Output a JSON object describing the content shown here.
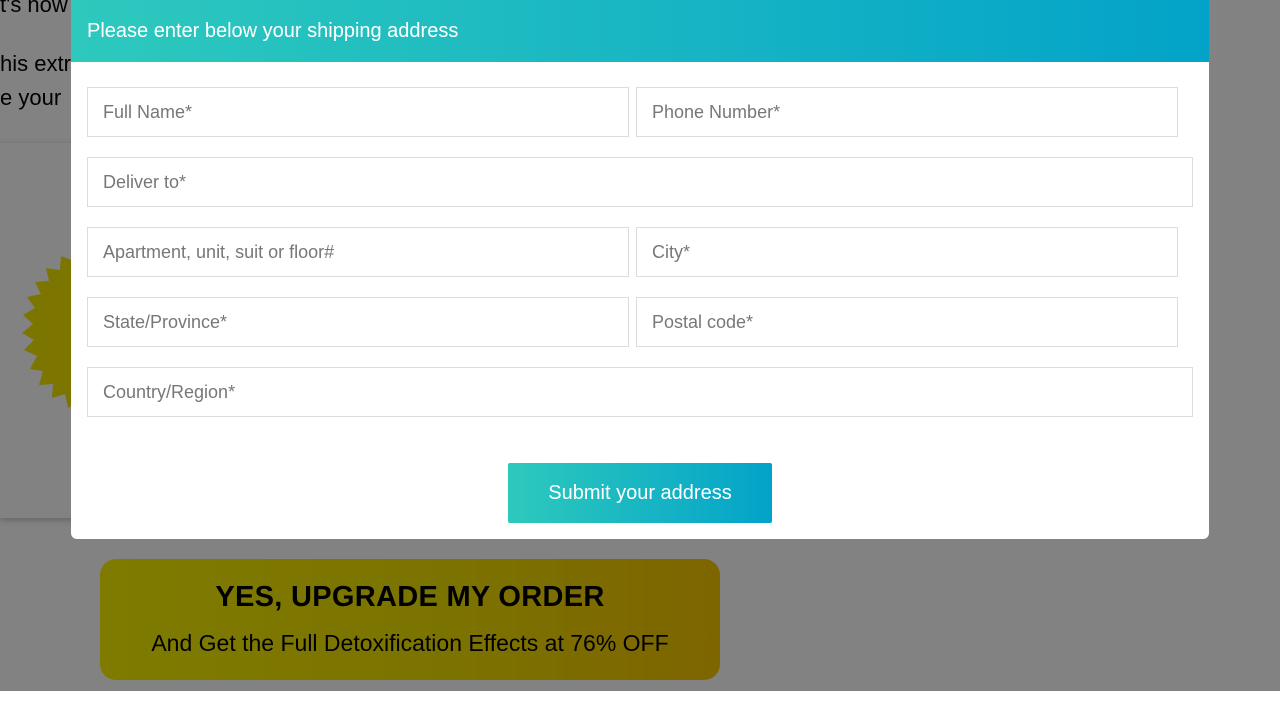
{
  "background_page": {
    "text_line_1": "t's now",
    "text_line_2": "his extr",
    "text_line_3": "e your",
    "upgrade_button": {
      "title": "YES, UPGRADE MY ORDER",
      "subtitle": "And Get the Full Detoxification Effects at 76% OFF"
    }
  },
  "modal": {
    "header": "Please enter below your shipping address",
    "fields": {
      "full_name": {
        "placeholder": "Full Name*",
        "value": ""
      },
      "phone": {
        "placeholder": "Phone Number*",
        "value": ""
      },
      "deliver_to": {
        "placeholder": "Deliver to*",
        "value": ""
      },
      "apartment": {
        "placeholder": "Apartment, unit, suit or floor#",
        "value": ""
      },
      "city": {
        "placeholder": "City*",
        "value": ""
      },
      "state": {
        "placeholder": "State/Province*",
        "value": ""
      },
      "postal_code": {
        "placeholder": "Postal code*",
        "value": ""
      },
      "country": {
        "placeholder": "Country/Region*",
        "value": ""
      }
    },
    "submit_label": "Submit your address"
  },
  "colors": {
    "header_gradient_start": "#2ec9bd",
    "header_gradient_end": "#03a3c9",
    "cta_yellow": "#f9f200",
    "overlay": "rgba(0,0,0,0.49)"
  }
}
